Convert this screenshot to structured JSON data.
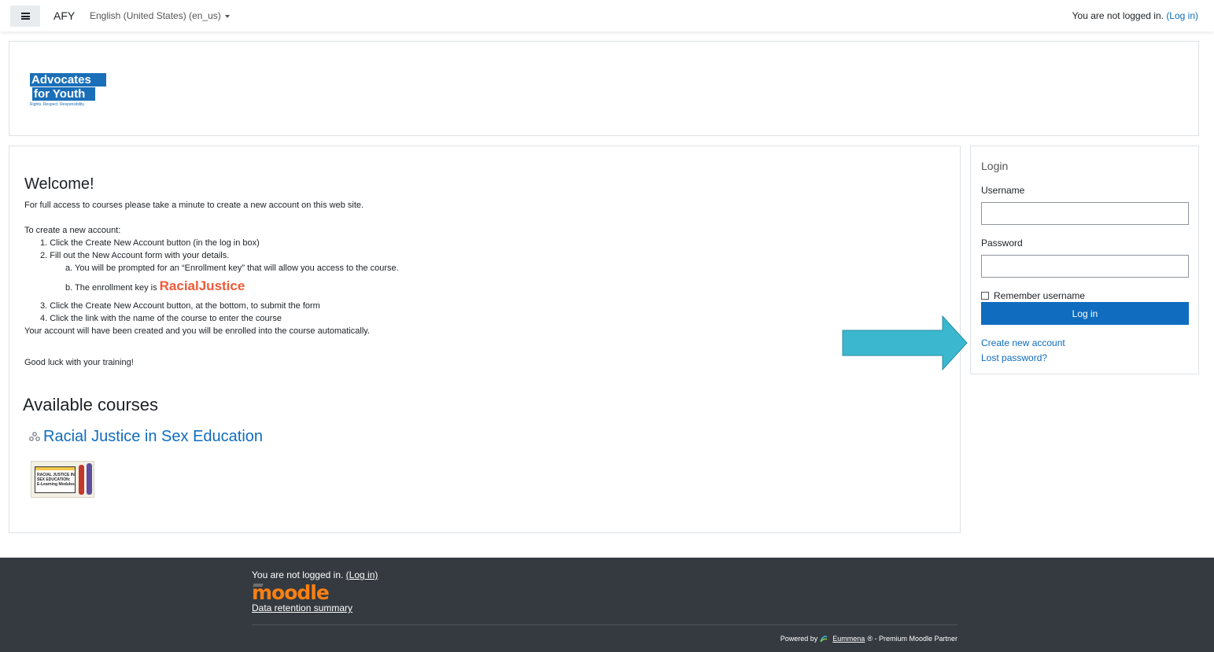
{
  "navbar": {
    "brand": "AFY",
    "language": "English (United States) (en_us)",
    "status_text": "You are not logged in.",
    "login_link": "(Log in)"
  },
  "header": {
    "logo_line1": "Advocates",
    "logo_line2": "for Youth",
    "logo_tagline": "Rights. Respect. Responsibility."
  },
  "main": {
    "welcome_title": "Welcome!",
    "intro": "For full access to courses please take a minute to create a new account on this web site.",
    "create_heading": "To create a new account:",
    "step1": "1. Click the Create New Account button (in the log in box)",
    "step2": "2. Fill out the New Account form with your details.",
    "step2a": "a. You will be prompted for an “Enrollment key” that will allow you access to the course.",
    "step2b_prefix": "b. The enrollment key is",
    "enrollment_key": "RacialJustice",
    "step3": "3. Click the Create New Account button, at the bottom, to submit the form",
    "step4": "4. Click the link with the name of the course to enter the course",
    "outro": "Your account will have been created and you will be enrolled into the course automatically.",
    "good_luck": "Good luck with your training!",
    "available_title": "Available courses",
    "course_name": "Racial Justice in Sex Education",
    "thumb_text": "RACIAL JUSTICE IN SEX EDUCATION: E-Learning Modules"
  },
  "login": {
    "title": "Login",
    "username_label": "Username",
    "username_value": "",
    "password_label": "Password",
    "password_value": "",
    "remember_label": "Remember username",
    "login_button": "Log in",
    "create_account": "Create new account",
    "lost_password": "Lost password?"
  },
  "footer": {
    "status_text": "You are not logged in.",
    "login_link": "(Log in)",
    "moodle_logo": "moodle",
    "data_retention": "Data retention summary",
    "powered_by": "Powered by",
    "eummena": "Eummena",
    "partner_text": "® - Premium Moodle Partner"
  },
  "colors": {
    "primary": "#0f6cbf",
    "key_accent": "#f05a37",
    "arrow": "#3bb8cf",
    "footer_bg": "#343a40",
    "moodle_orange": "#f98012"
  }
}
